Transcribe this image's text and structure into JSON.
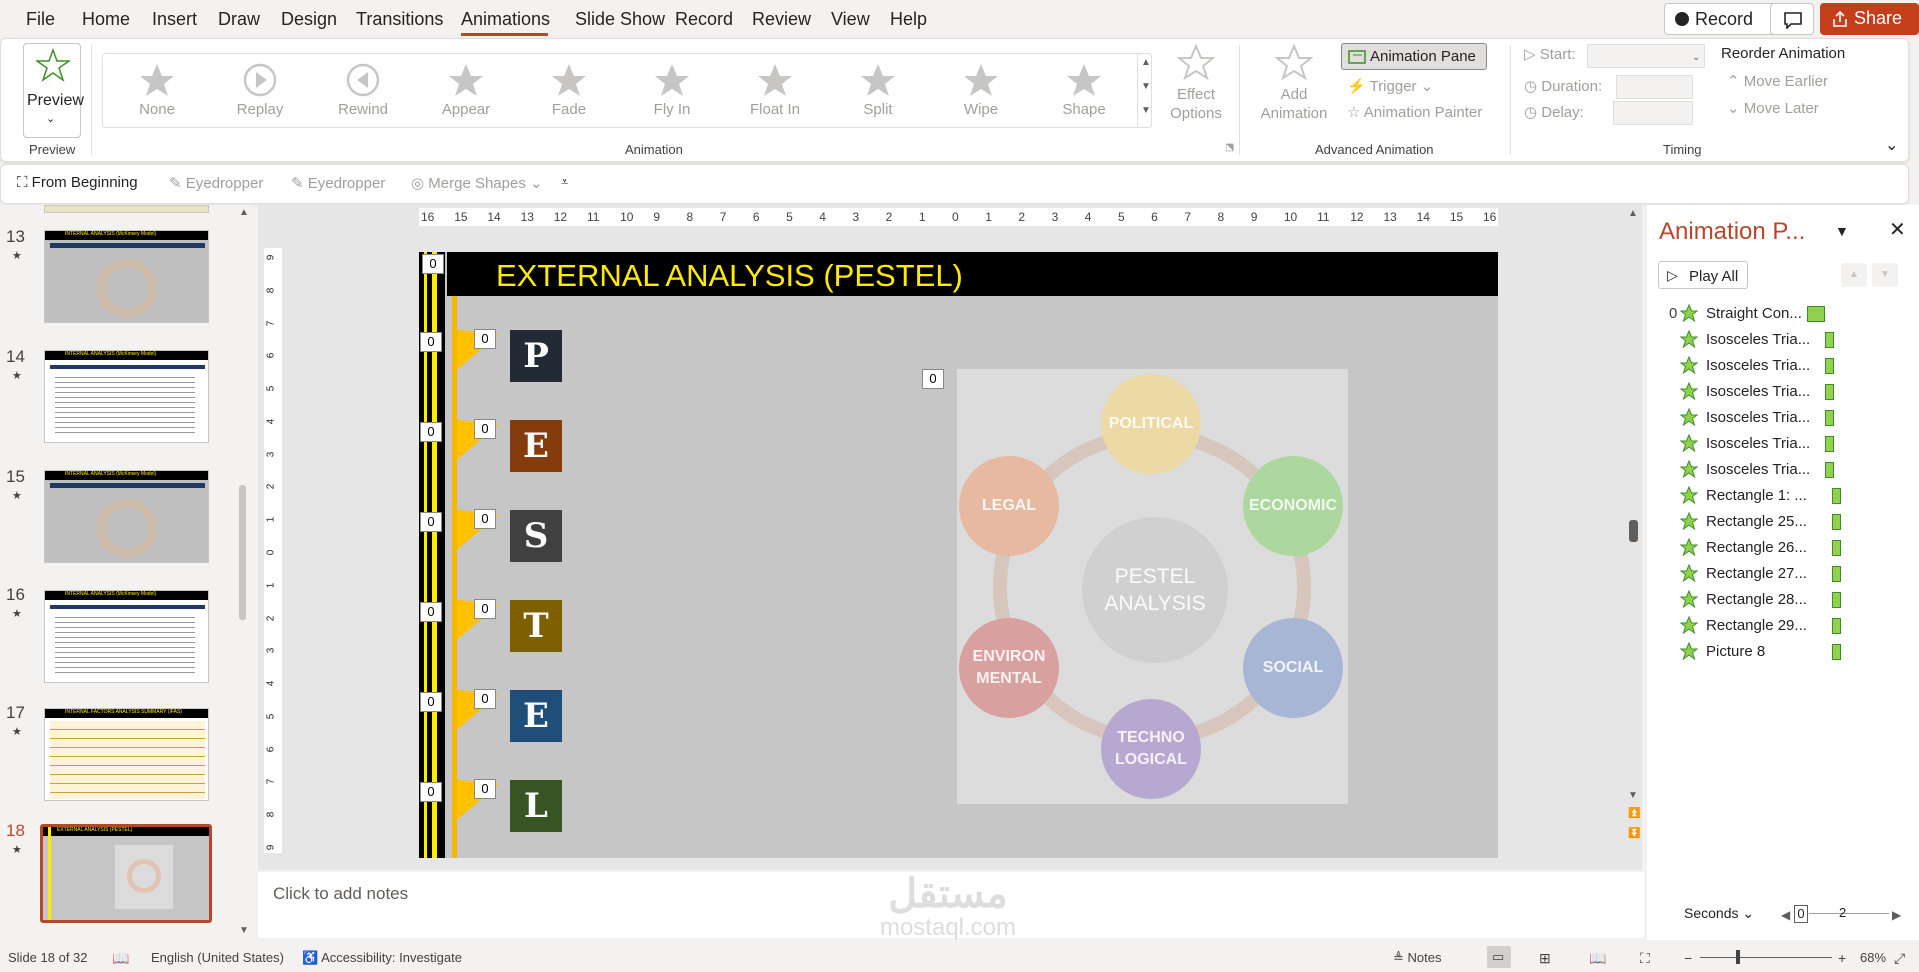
{
  "menu": {
    "items": [
      "File",
      "Home",
      "Insert",
      "Draw",
      "Design",
      "Transitions",
      "Animations",
      "Slide Show",
      "Record",
      "Review",
      "View",
      "Help"
    ],
    "active": "Animations",
    "record_label": "Record",
    "share_label": "Share"
  },
  "ribbon": {
    "preview_label": "Preview",
    "preview_group": "Preview",
    "animations": [
      "None",
      "Replay",
      "Rewind",
      "Appear",
      "Fade",
      "Fly In",
      "Float In",
      "Split",
      "Wipe",
      "Shape"
    ],
    "effect_options": [
      "Effect",
      "Options"
    ],
    "animation_group": "Animation",
    "add_animation": [
      "Add",
      "Animation"
    ],
    "animation_pane": "Animation Pane",
    "trigger": "Trigger",
    "animation_painter": "Animation Painter",
    "advanced_group": "Advanced Animation",
    "start_label": "Start:",
    "duration_label": "Duration:",
    "delay_label": "Delay:",
    "reorder_label": "Reorder Animation",
    "move_earlier": "Move Earlier",
    "move_later": "Move Later",
    "timing_group": "Timing"
  },
  "qat": {
    "from_beginning": "From Beginning",
    "eyedropper1": "Eyedropper",
    "eyedropper2": "Eyedropper",
    "merge_shapes": "Merge Shapes"
  },
  "thumbnails": [
    {
      "num": "13",
      "title": "INTERNAL ANALYSIS (McKinsey Model)"
    },
    {
      "num": "14",
      "title": "INTERNAL ANALYSIS (McKinsey Model)"
    },
    {
      "num": "15",
      "title": "INTERNAL ANALYSIS (McKinsey Model)"
    },
    {
      "num": "16",
      "title": "INTERNAL ANALYSIS (McKinsey Model)"
    },
    {
      "num": "17",
      "title": "INTERNAL FACTORS ANALYSIS SUMMARY (IFAS)"
    },
    {
      "num": "18",
      "title": "EXTERNAL ANALYSIS (PESTEL)"
    }
  ],
  "ruler_h": [
    "16",
    "15",
    "14",
    "13",
    "12",
    "11",
    "10",
    "9",
    "8",
    "7",
    "6",
    "5",
    "4",
    "3",
    "2",
    "1",
    "0",
    "1",
    "2",
    "3",
    "4",
    "5",
    "6",
    "7",
    "8",
    "9",
    "10",
    "11",
    "12",
    "13",
    "14",
    "15",
    "16"
  ],
  "ruler_v": [
    "9",
    "8",
    "7",
    "6",
    "5",
    "4",
    "3",
    "2",
    "1",
    "0",
    "1",
    "2",
    "3",
    "4",
    "5",
    "6",
    "7",
    "8",
    "9"
  ],
  "slide": {
    "title": "EXTERNAL ANALYSIS (PESTEL)",
    "letters": [
      {
        "char": "P",
        "color": "#222a35"
      },
      {
        "char": "E",
        "color": "#843c0c"
      },
      {
        "char": "S",
        "color": "#404040"
      },
      {
        "char": "T",
        "color": "#7f6000"
      },
      {
        "char": "E",
        "color": "#1f4e79"
      },
      {
        "char": "L",
        "color": "#375623"
      }
    ],
    "badge": "0",
    "pestel": {
      "center": [
        "PESTEL",
        "ANALYSIS"
      ],
      "political": "POLITICAL",
      "economic": "ECONOMIC",
      "social": "SOCIAL",
      "techno": [
        "TECHNO",
        "LOGICAL"
      ],
      "environ": [
        "ENVIRON",
        "MENTAL"
      ],
      "legal": "LEGAL"
    }
  },
  "notes_placeholder": "Click to add notes",
  "anim_pane": {
    "title": "Animation P...",
    "play_all": "Play All",
    "first_index": "0",
    "items": [
      "Straight Con...",
      "Isosceles Tria...",
      "Isosceles Tria...",
      "Isosceles Tria...",
      "Isosceles Tria...",
      "Isosceles Tria...",
      "Isosceles Tria...",
      "Rectangle 1: ...",
      "Rectangle 25...",
      "Rectangle 26...",
      "Rectangle 27...",
      "Rectangle 28...",
      "Rectangle 29...",
      "Picture 8"
    ],
    "seconds_label": "Seconds",
    "timeline_start": "0",
    "timeline_end": "2"
  },
  "status": {
    "slide_info": "Slide 18 of 32",
    "language": "English (United States)",
    "accessibility": "Accessibility: Investigate",
    "notes": "Notes",
    "zoom": "68%"
  },
  "watermark": {
    "arabic": "مستقل",
    "latin": "mostaql.com"
  }
}
